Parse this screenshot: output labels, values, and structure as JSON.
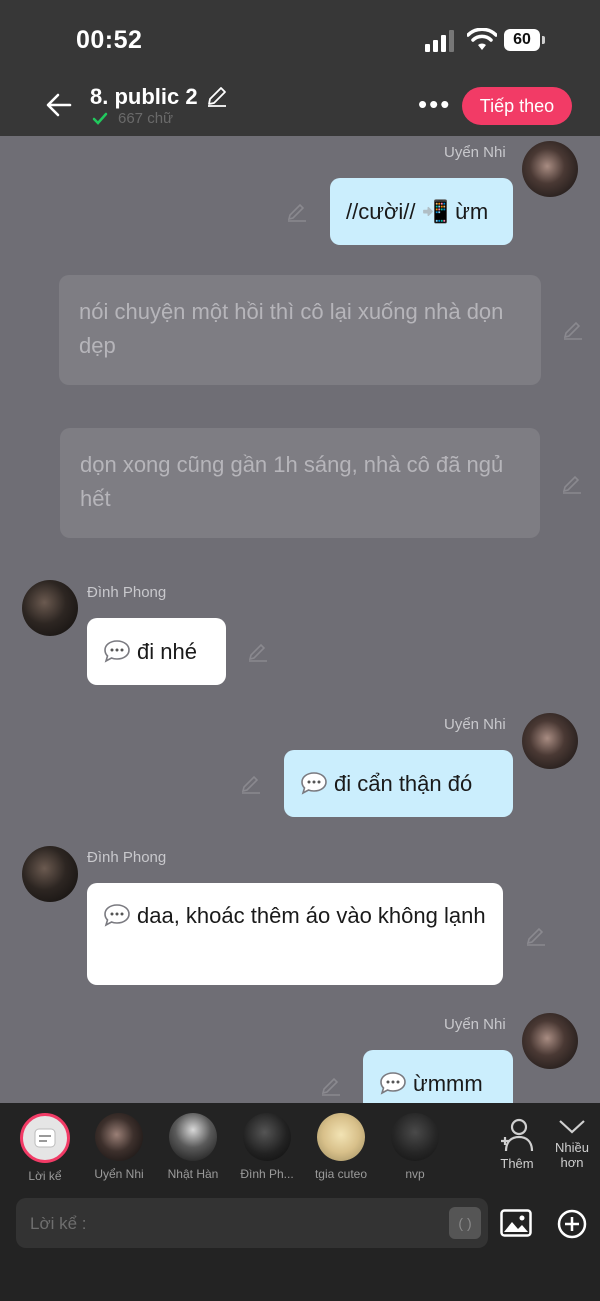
{
  "status": {
    "time": "00:52",
    "battery": "60"
  },
  "header": {
    "title": "8. public 2",
    "word_count": "667 chữ",
    "more": "•••",
    "next_label": "Tiếp theo"
  },
  "messages": [
    {
      "speaker": "Uyển Nhi",
      "text": "//cười// 📲 ừm"
    },
    {
      "text": "nói chuyện một hồi thì cô lại xuống nhà dọn dẹp"
    },
    {
      "text": "dọn xong cũng gần 1h sáng, nhà cô đã ngủ hết"
    },
    {
      "speaker": "Đình Phong",
      "text": "đi nhé"
    },
    {
      "speaker": "Uyển Nhi",
      "text": "đi cẩn thận đó"
    },
    {
      "speaker": "Đình Phong",
      "text": "daa, khoác thêm áo vào không lạnh"
    },
    {
      "speaker": "Uyển Nhi",
      "text": "ừmmm"
    }
  ],
  "characters": [
    {
      "label": "Lời kể"
    },
    {
      "label": "Uyển Nhi"
    },
    {
      "label": "Nhật Hàn"
    },
    {
      "label": "Đình Ph..."
    },
    {
      "label": "tgia cuteo"
    },
    {
      "label": "nvp"
    }
  ],
  "actions": {
    "add_label": "Thêm",
    "more_label_1": "Nhiều",
    "more_label_2": "hơn"
  },
  "composer": {
    "placeholder": "Lời kể :",
    "bracket": "( )"
  },
  "colors": {
    "accent": "#f23b66",
    "bubble_blue": "#cbeefd",
    "background": "#6f6e75"
  }
}
